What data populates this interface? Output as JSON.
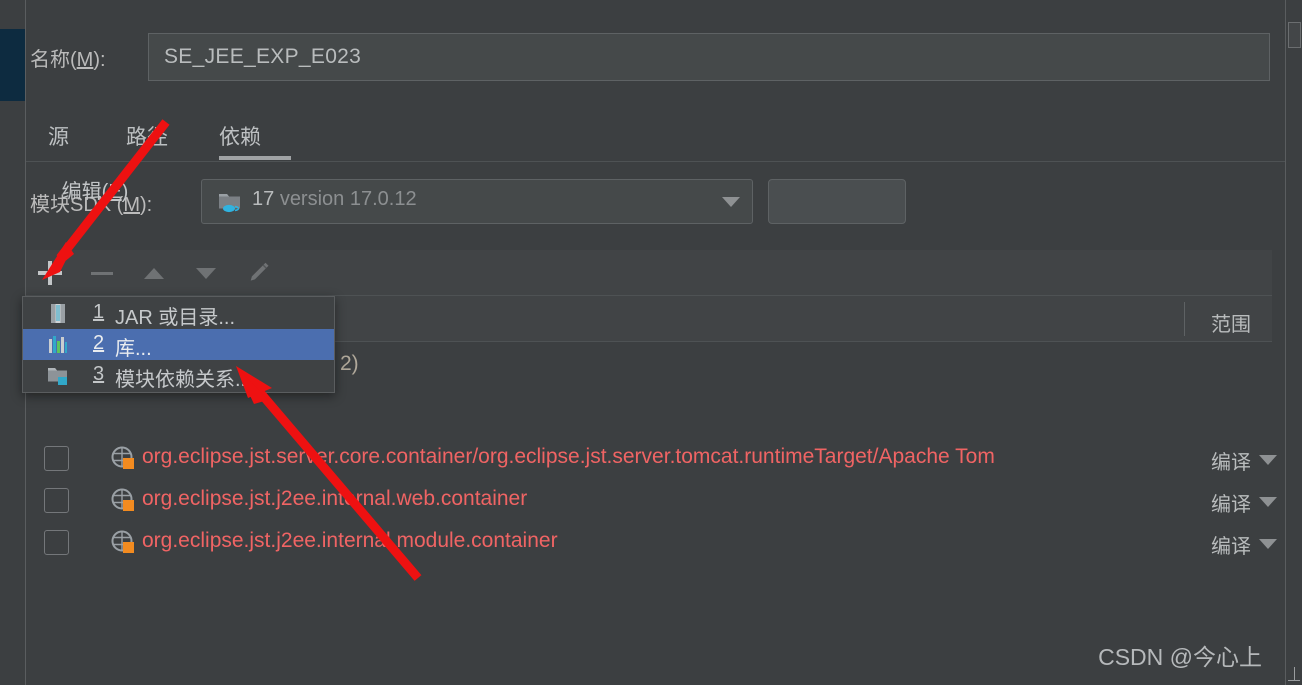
{
  "window": {
    "watermark": "CSDN @今心上"
  },
  "name_row": {
    "label_prefix": "名称(",
    "label_mnemonic": "M",
    "label_suffix": "):",
    "value": "SE_JEE_EXP_E023",
    "placeholder": ""
  },
  "tabs": {
    "items": [
      {
        "label": "源",
        "active": false
      },
      {
        "label": "路径",
        "active": false
      },
      {
        "label": "依赖",
        "active": true
      }
    ]
  },
  "sdk_row": {
    "label_prefix": "模块SDK (",
    "label_mnemonic": "M",
    "label_suffix": "):",
    "combo_icon": "java-sdk-folder-icon",
    "combo_value_name": "17",
    "combo_value_version": "version 17.0.12",
    "edit_button_prefix": "编辑(",
    "edit_button_mnemonic": "E",
    "edit_button_suffix": ")"
  },
  "toolbar": {
    "buttons": [
      {
        "name": "add-button",
        "icon": "plus-icon",
        "enabled": true
      },
      {
        "name": "remove-button",
        "icon": "minus-icon",
        "enabled": false
      },
      {
        "name": "move-up-button",
        "icon": "arrow-up-icon",
        "enabled": false
      },
      {
        "name": "move-down-button",
        "icon": "arrow-down-icon",
        "enabled": false
      },
      {
        "name": "edit-button",
        "icon": "pencil-icon",
        "enabled": false
      }
    ]
  },
  "popup_menu": {
    "items": [
      {
        "number": "1",
        "label": "JAR 或目录...",
        "icon": "jar-archive-icon",
        "selected": false
      },
      {
        "number": "2",
        "label": "库...",
        "icon": "library-icon",
        "selected": true
      },
      {
        "number": "3",
        "label": "模块依赖关系...",
        "icon": "module-folder-icon",
        "selected": false
      }
    ]
  },
  "table": {
    "headers": {
      "export": "",
      "name": "",
      "scope": "范围"
    },
    "hidden_row_fragment": "2)",
    "rows": [
      {
        "checked": false,
        "icon": "globe-error-icon",
        "name": "org.eclipse.jst.server.core.container/org.eclipse.jst.server.tomcat.runtimeTarget/Apache Tom",
        "scope": "编译"
      },
      {
        "checked": false,
        "icon": "globe-error-icon",
        "name": "org.eclipse.jst.j2ee.internal.web.container",
        "scope": "编译"
      },
      {
        "checked": false,
        "icon": "globe-error-icon",
        "name": "org.eclipse.jst.j2ee.internal.module.container",
        "scope": "编译"
      }
    ]
  },
  "colors": {
    "background": "#3c3f41",
    "panel_alt": "#414446",
    "field": "#45494a",
    "text": "#bbbbbb",
    "error_text": "#f06464",
    "selection": "#4b6eaf",
    "rail_selection": "#0d2b40",
    "annotation_arrow": "#ee1111"
  },
  "annotations": [
    {
      "name": "arrow-to-add-button"
    },
    {
      "name": "arrow-to-library-menu-item"
    }
  ]
}
